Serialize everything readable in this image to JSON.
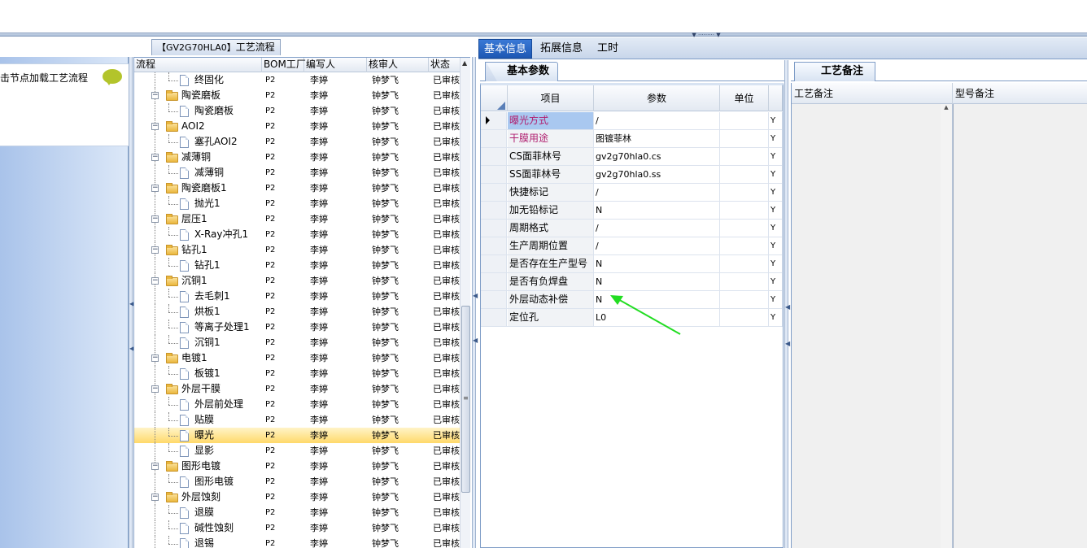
{
  "left_panel": {
    "hint_text": "击节点加载工艺流程"
  },
  "tree_panel": {
    "caption_code": "【GV2G70HLA0】",
    "caption_title": "工艺流程",
    "columns": [
      "流程",
      "BOM工厂",
      "编写人",
      "核审人",
      "状态"
    ],
    "rows": [
      {
        "level": 2,
        "type": "doc",
        "name": "终固化",
        "bom": "P2",
        "writer": "李婷",
        "reviewer": "钟梦飞",
        "status": "已审核"
      },
      {
        "level": 1,
        "type": "folder",
        "name": "陶瓷磨板",
        "bom": "P2",
        "writer": "李婷",
        "reviewer": "钟梦飞",
        "status": "已审核"
      },
      {
        "level": 2,
        "type": "doc",
        "name": "陶瓷磨板",
        "bom": "P2",
        "writer": "李婷",
        "reviewer": "钟梦飞",
        "status": "已审核"
      },
      {
        "level": 1,
        "type": "folder",
        "name": "AOI2",
        "bom": "P2",
        "writer": "李婷",
        "reviewer": "钟梦飞",
        "status": "已审核"
      },
      {
        "level": 2,
        "type": "doc",
        "name": "塞孔AOI2",
        "bom": "P2",
        "writer": "李婷",
        "reviewer": "钟梦飞",
        "status": "已审核"
      },
      {
        "level": 1,
        "type": "folder",
        "name": "减薄铜",
        "bom": "P2",
        "writer": "李婷",
        "reviewer": "钟梦飞",
        "status": "已审核"
      },
      {
        "level": 2,
        "type": "doc",
        "name": "减薄铜",
        "bom": "P2",
        "writer": "李婷",
        "reviewer": "钟梦飞",
        "status": "已审核"
      },
      {
        "level": 1,
        "type": "folder",
        "name": "陶瓷磨板1",
        "bom": "P2",
        "writer": "李婷",
        "reviewer": "钟梦飞",
        "status": "已审核"
      },
      {
        "level": 2,
        "type": "doc",
        "name": "抛光1",
        "bom": "P2",
        "writer": "李婷",
        "reviewer": "钟梦飞",
        "status": "已审核"
      },
      {
        "level": 1,
        "type": "folder",
        "name": "层压1",
        "bom": "P2",
        "writer": "李婷",
        "reviewer": "钟梦飞",
        "status": "已审核"
      },
      {
        "level": 2,
        "type": "doc",
        "name": "X-Ray冲孔1",
        "bom": "P2",
        "writer": "李婷",
        "reviewer": "钟梦飞",
        "status": "已审核"
      },
      {
        "level": 1,
        "type": "folder",
        "name": "钻孔1",
        "bom": "P2",
        "writer": "李婷",
        "reviewer": "钟梦飞",
        "status": "已审核"
      },
      {
        "level": 2,
        "type": "doc",
        "name": "钻孔1",
        "bom": "P2",
        "writer": "李婷",
        "reviewer": "钟梦飞",
        "status": "已审核"
      },
      {
        "level": 1,
        "type": "folder",
        "name": "沉铜1",
        "bom": "P2",
        "writer": "李婷",
        "reviewer": "钟梦飞",
        "status": "已审核"
      },
      {
        "level": 2,
        "type": "doc",
        "name": "去毛刺1",
        "bom": "P2",
        "writer": "李婷",
        "reviewer": "钟梦飞",
        "status": "已审核"
      },
      {
        "level": 2,
        "type": "doc",
        "name": "烘板1",
        "bom": "P2",
        "writer": "李婷",
        "reviewer": "钟梦飞",
        "status": "已审核"
      },
      {
        "level": 2,
        "type": "doc",
        "name": "等离子处理1",
        "bom": "P2",
        "writer": "李婷",
        "reviewer": "钟梦飞",
        "status": "已审核"
      },
      {
        "level": 2,
        "type": "doc",
        "name": "沉铜1",
        "bom": "P2",
        "writer": "李婷",
        "reviewer": "钟梦飞",
        "status": "已审核"
      },
      {
        "level": 1,
        "type": "folder",
        "name": "电镀1",
        "bom": "P2",
        "writer": "李婷",
        "reviewer": "钟梦飞",
        "status": "已审核"
      },
      {
        "level": 2,
        "type": "doc",
        "name": "板镀1",
        "bom": "P2",
        "writer": "李婷",
        "reviewer": "钟梦飞",
        "status": "已审核"
      },
      {
        "level": 1,
        "type": "folder",
        "name": "外层干膜",
        "bom": "P2",
        "writer": "李婷",
        "reviewer": "钟梦飞",
        "status": "已审核"
      },
      {
        "level": 2,
        "type": "doc",
        "name": "外层前处理",
        "bom": "P2",
        "writer": "李婷",
        "reviewer": "钟梦飞",
        "status": "已审核"
      },
      {
        "level": 2,
        "type": "doc",
        "name": "贴膜",
        "bom": "P2",
        "writer": "李婷",
        "reviewer": "钟梦飞",
        "status": "已审核"
      },
      {
        "level": 2,
        "type": "doc",
        "name": "曝光",
        "bom": "P2",
        "writer": "李婷",
        "reviewer": "钟梦飞",
        "status": "已审核",
        "selected": true
      },
      {
        "level": 2,
        "type": "doc",
        "name": "显影",
        "bom": "P2",
        "writer": "李婷",
        "reviewer": "钟梦飞",
        "status": "已审核"
      },
      {
        "level": 1,
        "type": "folder",
        "name": "图形电镀",
        "bom": "P2",
        "writer": "李婷",
        "reviewer": "钟梦飞",
        "status": "已审核"
      },
      {
        "level": 2,
        "type": "doc",
        "name": "图形电镀",
        "bom": "P2",
        "writer": "李婷",
        "reviewer": "钟梦飞",
        "status": "已审核"
      },
      {
        "level": 1,
        "type": "folder",
        "name": "外层蚀刻",
        "bom": "P2",
        "writer": "李婷",
        "reviewer": "钟梦飞",
        "status": "已审核"
      },
      {
        "level": 2,
        "type": "doc",
        "name": "退膜",
        "bom": "P2",
        "writer": "李婷",
        "reviewer": "钟梦飞",
        "status": "已审核"
      },
      {
        "level": 2,
        "type": "doc",
        "name": "碱性蚀刻",
        "bom": "P2",
        "writer": "李婷",
        "reviewer": "钟梦飞",
        "status": "已审核"
      },
      {
        "level": 2,
        "type": "doc",
        "name": "退锡",
        "bom": "P2",
        "writer": "李婷",
        "reviewer": "钟梦飞",
        "status": "已审核"
      }
    ]
  },
  "main_tabs": [
    "基本信息",
    "拓展信息",
    "工时"
  ],
  "params_panel": {
    "tab": "基本参数",
    "columns": [
      "项目",
      "参数",
      "单位"
    ],
    "rows": [
      {
        "key": "曝光方式",
        "value": "/",
        "unit": "",
        "flag": "Y",
        "red": true,
        "current": true
      },
      {
        "key": "干膜用途",
        "value": "图镀菲林",
        "unit": "",
        "flag": "Y",
        "red": true
      },
      {
        "key": "CS面菲林号",
        "value": "gv2g70hla0.cs",
        "unit": "",
        "flag": "Y"
      },
      {
        "key": "SS面菲林号",
        "value": "gv2g70hla0.ss",
        "unit": "",
        "flag": "Y"
      },
      {
        "key": "快捷标记",
        "value": "/",
        "unit": "",
        "flag": "Y"
      },
      {
        "key": "加无铅标记",
        "value": "N",
        "unit": "",
        "flag": "Y"
      },
      {
        "key": "周期格式",
        "value": "/",
        "unit": "",
        "flag": "Y"
      },
      {
        "key": "生产周期位置",
        "value": "/",
        "unit": "",
        "flag": "Y"
      },
      {
        "key": "是否存在生产型号",
        "value": "N",
        "unit": "",
        "flag": "Y"
      },
      {
        "key": "是否有负焊盘",
        "value": "N",
        "unit": "",
        "flag": "Y"
      },
      {
        "key": "外层动态补偿",
        "value": "N",
        "unit": "",
        "flag": "Y"
      },
      {
        "key": "定位孔",
        "value": "L0",
        "unit": "",
        "flag": "Y"
      }
    ]
  },
  "notes_panel": {
    "tab": "工艺备注",
    "columns": [
      "工艺备注",
      "型号备注"
    ]
  },
  "colors": {
    "accent": "#1d58b4",
    "selection": "#ffd96a",
    "annotation_arrow": "#22dd22"
  }
}
